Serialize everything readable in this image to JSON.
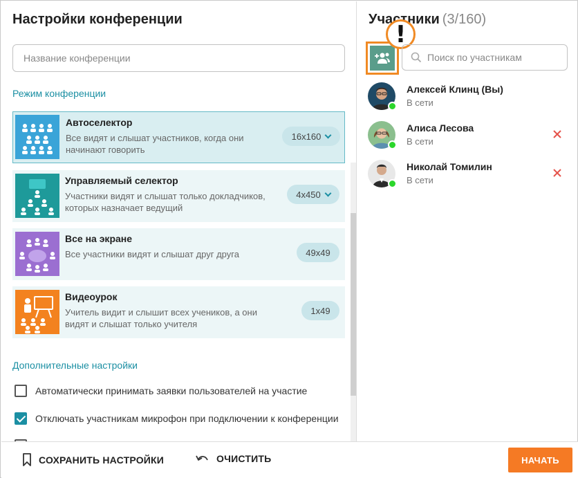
{
  "conference_settings": {
    "title": "Настройки конференции",
    "name_input": {
      "placeholder": "Название конференции",
      "value": ""
    },
    "mode_section_title": "Режим конференции",
    "modes": [
      {
        "name": "Автоселектор",
        "description": "Все видят и слышат участников, когда они начинают говорить",
        "limit": "16x160",
        "has_dropdown": true,
        "selected": true,
        "color": "#3aa4d8"
      },
      {
        "name": "Управляемый селектор",
        "description": "Участники видят и слышат только докладчиков, которых назначает ведущий",
        "limit": "4x450",
        "has_dropdown": true,
        "selected": false,
        "color": "#1e9a9a"
      },
      {
        "name": "Все на экране",
        "description": "Все участники видят и слышат друг друга",
        "limit": "49x49",
        "has_dropdown": false,
        "selected": false,
        "color": "#9b6fd1"
      },
      {
        "name": "Видеоурок",
        "description": "Учитель видит и слышит всех учеников, а они видят и слышат только учителя",
        "limit": "1x49",
        "has_dropdown": false,
        "selected": false,
        "color": "#f3821f"
      }
    ],
    "additional_section_title": "Дополнительные настройки",
    "options": [
      {
        "label": "Автоматически принимать заявки пользователей на участие",
        "checked": false
      },
      {
        "label": "Отключать участникам микрофон при подключении к конференции",
        "checked": true
      }
    ]
  },
  "participants_panel": {
    "title": "Участники",
    "count": "(3/160)",
    "add_button_icon": "add-user-icon",
    "alert_mark": "!",
    "search": {
      "placeholder": "Поиск по участникам",
      "value": ""
    },
    "participants": [
      {
        "name": "Алексей Клинц (Вы)",
        "status": "В сети",
        "removable": false,
        "online": true
      },
      {
        "name": "Алиса Лесова",
        "status": "В сети",
        "removable": true,
        "online": true
      },
      {
        "name": "Николай Томилин",
        "status": "В сети",
        "removable": true,
        "online": true
      }
    ]
  },
  "footer": {
    "save_label": "СОХРАНИТЬ НАСТРОЙКИ",
    "clear_label": "ОЧИСТИТЬ",
    "start_label": "НАЧАТЬ"
  },
  "colors": {
    "accent_teal": "#1b8fa3",
    "highlight_orange": "#f08a24",
    "start_button": "#f57a24",
    "online": "#2bd62b",
    "remove": "#e5534b"
  }
}
